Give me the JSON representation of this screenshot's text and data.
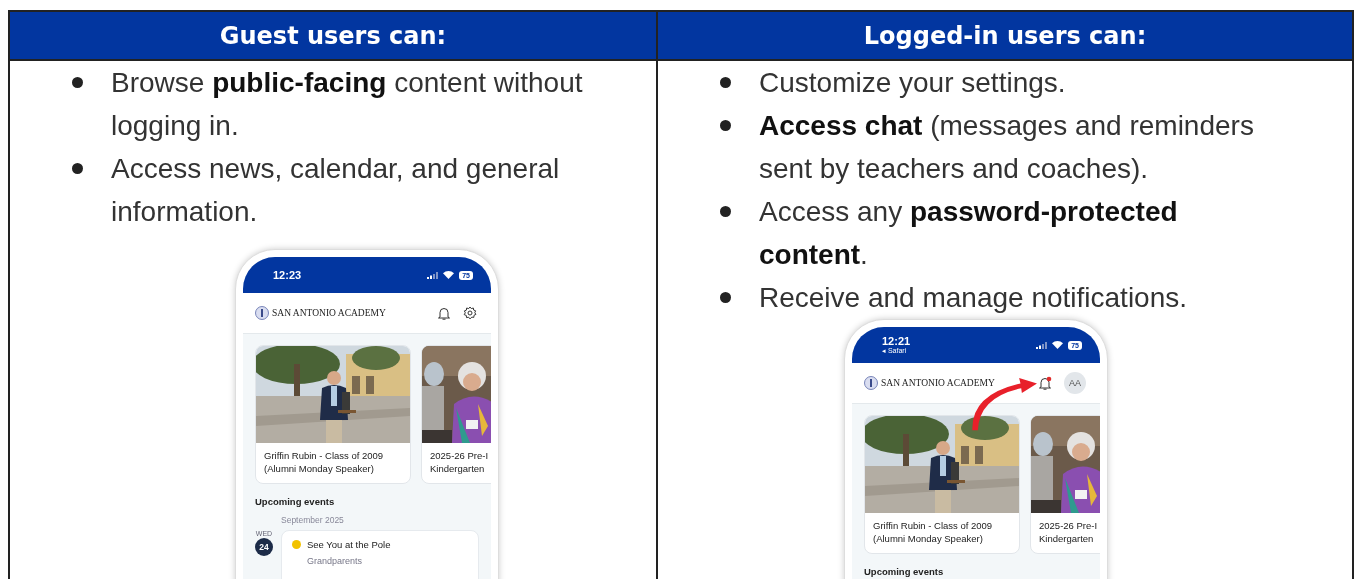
{
  "columns": [
    {
      "heading": "Guest users can:",
      "bullets": [
        "Browse **public-facing** content without logging in.",
        "Access news, calendar, and general information."
      ],
      "phone": {
        "time": "12:23",
        "battery": "75",
        "app_title": "SAN ANTONIO ACADEMY",
        "actions": [
          {
            "kind": "bell",
            "badge": false
          },
          {
            "kind": "settings"
          }
        ],
        "cards": [
          {
            "caption": "Griffin Rubin - Class of 2009 (Alumni Monday Speaker)"
          },
          {
            "caption": "2025-26 Pre-I Kindergarten"
          }
        ],
        "section_title": "Upcoming events",
        "month": "September 2025",
        "events": [
          {
            "weekday": "WED",
            "day": "24",
            "title": "See You at the Pole",
            "subtitle": "Grandparents",
            "color": "#f2c200"
          }
        ]
      }
    },
    {
      "heading": "Logged-in users can:",
      "bullets": [
        "Customize your settings.",
        "**Access chat** (messages and reminders sent by teachers and coaches).",
        "Access any **password-protected content**.",
        "Receive and manage notifications."
      ],
      "phone": {
        "time": "12:21",
        "back_label": "◂ Safari",
        "battery": "75",
        "app_title": "SAN ANTONIO ACADEMY",
        "actions": [
          {
            "kind": "bell",
            "badge": true
          },
          {
            "kind": "avatar",
            "initials": "AA"
          }
        ],
        "cards": [
          {
            "caption": "Griffin Rubin - Class of 2009 (Alumni Monday Speaker)"
          },
          {
            "caption": "2025-26 Pre-I Kindergarten"
          }
        ],
        "section_title": "Upcoming events",
        "arrow": true
      }
    }
  ]
}
